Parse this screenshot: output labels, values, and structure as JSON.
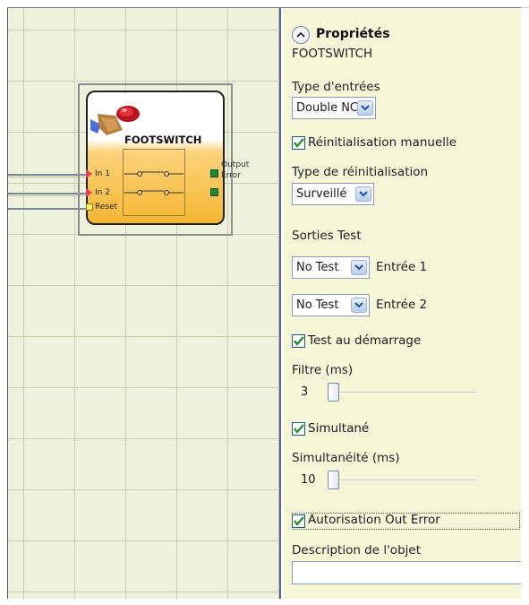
{
  "component": {
    "title": "FOOTSWITCH",
    "inputs": [
      "In 1",
      "In 2",
      "Reset"
    ],
    "outputs": [
      "Output",
      "Error"
    ]
  },
  "panel": {
    "title": "Propriétés",
    "subtitle": "FOOTSWITCH",
    "type_entrees": {
      "label": "Type d'entrées",
      "value": "Double NC"
    },
    "reinit_manuelle": {
      "label": "Réinitialisation manuelle",
      "checked": true
    },
    "type_reinit": {
      "label": "Type de réinitialisation",
      "value": "Surveillé"
    },
    "sorties_test": {
      "label": "Sorties Test"
    },
    "test1": {
      "value": "No Test",
      "label": "Entrée 1"
    },
    "test2": {
      "value": "No Test",
      "label": "Entrée 2"
    },
    "test_demarrage": {
      "label": "Test au démarrage",
      "checked": true
    },
    "filtre": {
      "label": "Filtre (ms)",
      "value": "3"
    },
    "simultane": {
      "label": "Simultané",
      "checked": true
    },
    "simultaneite": {
      "label": "Simultanéité (ms)",
      "value": "10"
    },
    "autorisation": {
      "label": "Autorisation Out Error",
      "checked": true
    },
    "description": {
      "label": "Description de l'objet",
      "value": ""
    }
  },
  "colors": {
    "canvas_bg": "#eef2dc",
    "panel_bg": "#f6f7d9",
    "block_fill": "#f6b733",
    "port_input": "#e0405a",
    "port_output": "#1f8a2c",
    "reset_port": "#ffef6a"
  }
}
